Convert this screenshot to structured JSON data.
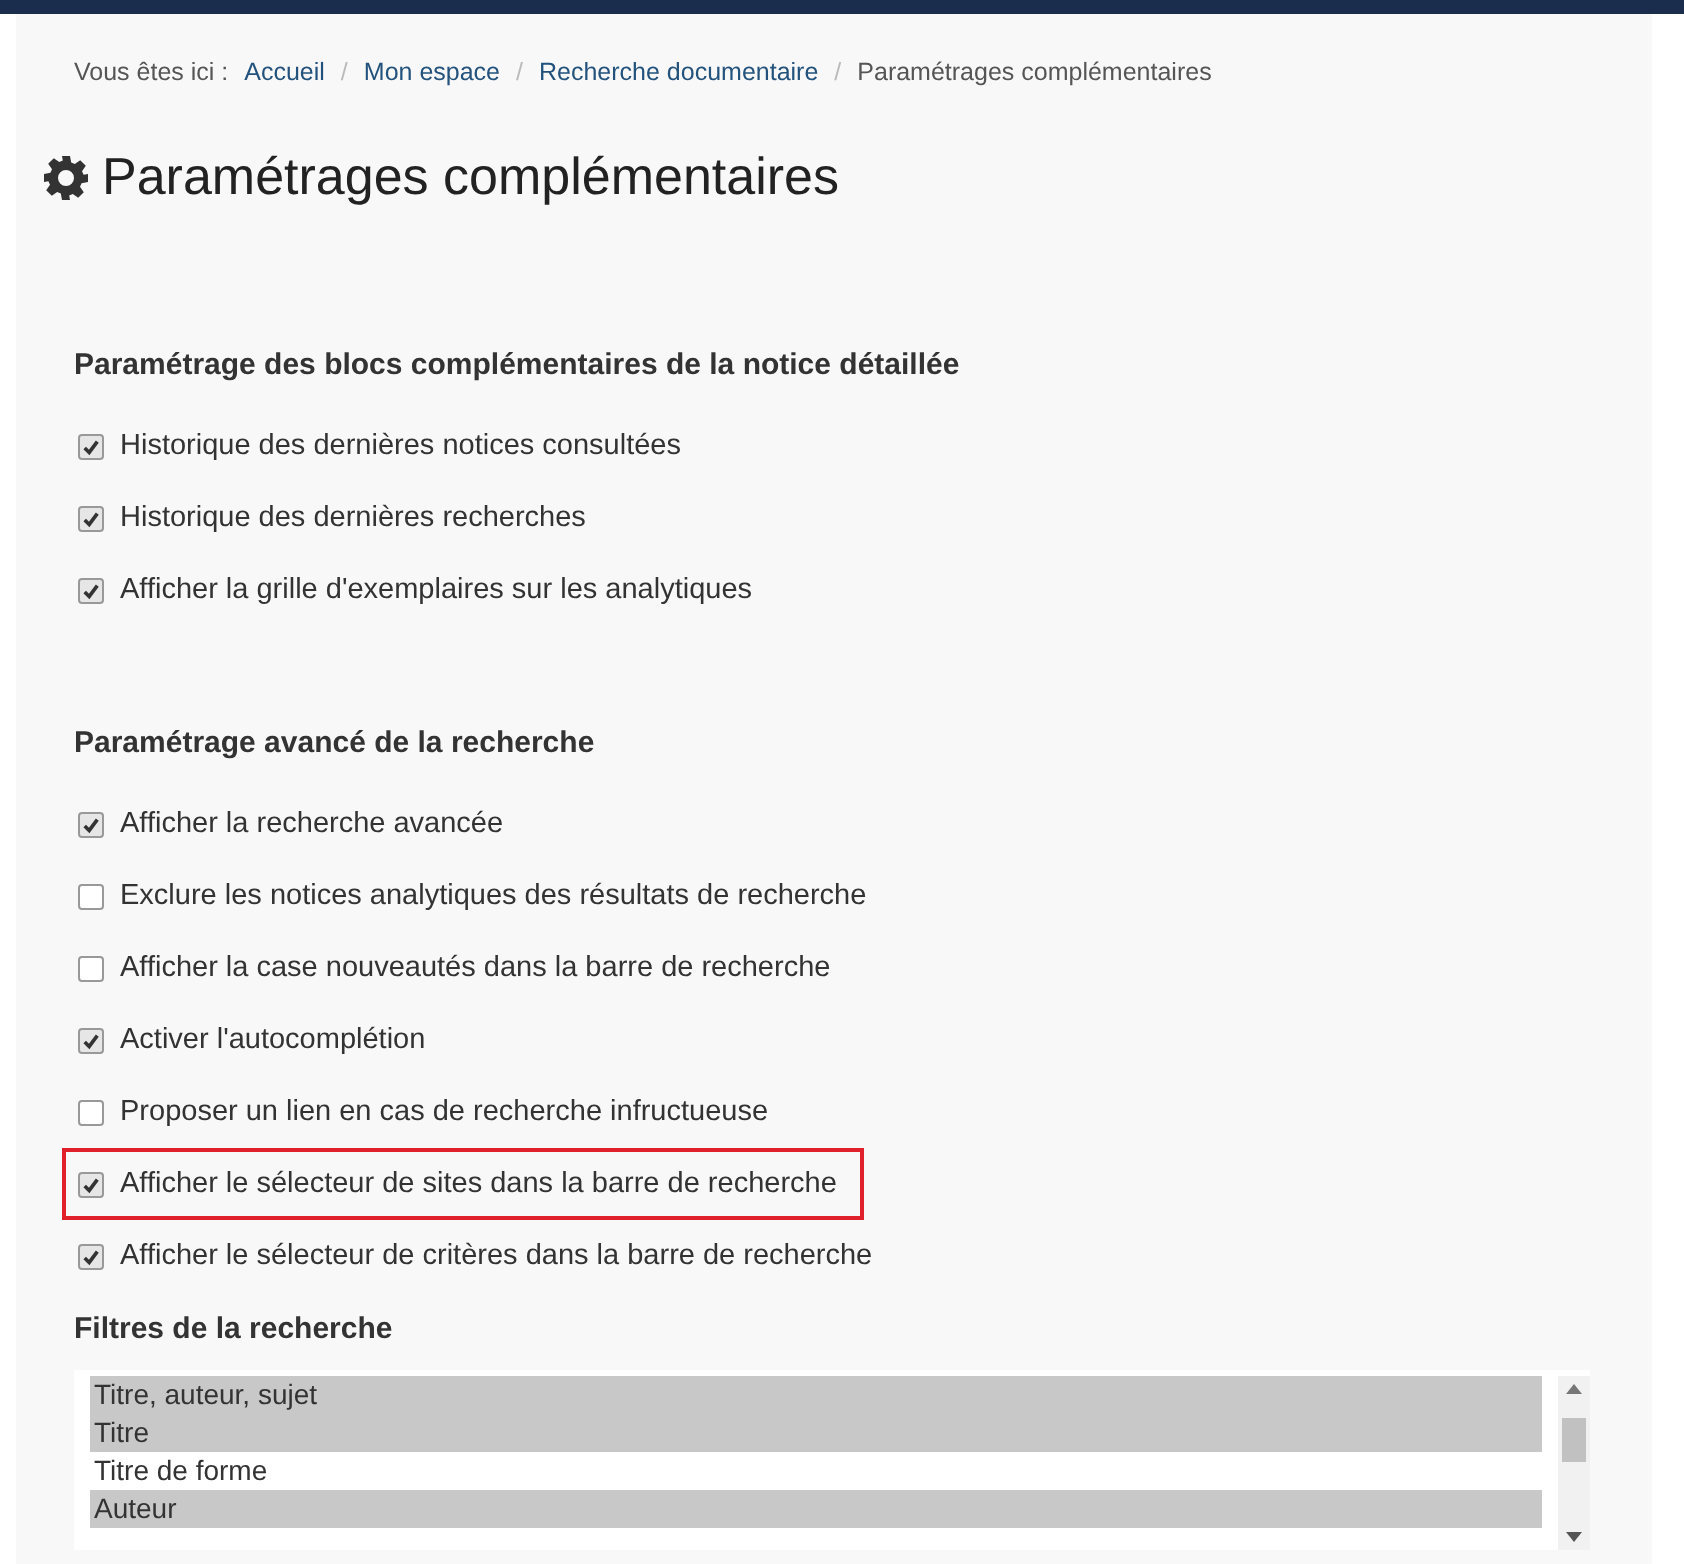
{
  "breadcrumb": {
    "label": "Vous êtes ici :",
    "separator": "/",
    "items": [
      {
        "text": "Accueil",
        "kind": "link"
      },
      {
        "text": "Mon espace",
        "kind": "link"
      },
      {
        "text": "Recherche documentaire",
        "kind": "link"
      },
      {
        "text": "Paramétrages complémentaires",
        "kind": "current"
      }
    ]
  },
  "title": "Paramétrages complémentaires",
  "sections": [
    {
      "heading": "Paramétrage des blocs complémentaires de la notice détaillée",
      "options": [
        {
          "label": "Historique des dernières notices consultées",
          "checked": true,
          "highlighted": false
        },
        {
          "label": "Historique des dernières recherches",
          "checked": true,
          "highlighted": false
        },
        {
          "label": "Afficher la grille d'exemplaires sur les analytiques",
          "checked": true,
          "highlighted": false
        }
      ]
    },
    {
      "heading": "Paramétrage avancé de la recherche",
      "options": [
        {
          "label": "Afficher la recherche avancée",
          "checked": true,
          "highlighted": false
        },
        {
          "label": "Exclure les notices analytiques des résultats de recherche",
          "checked": false,
          "highlighted": false
        },
        {
          "label": "Afficher la case nouveautés dans la barre de recherche",
          "checked": false,
          "highlighted": false
        },
        {
          "label": "Activer l'autocomplétion",
          "checked": true,
          "highlighted": false
        },
        {
          "label": "Proposer un lien en cas de recherche infructueuse",
          "checked": false,
          "highlighted": false
        },
        {
          "label": "Afficher le sélecteur de sites dans la barre de recherche",
          "checked": true,
          "highlighted": true
        },
        {
          "label": "Afficher le sélecteur de critères dans la barre de recherche",
          "checked": true,
          "highlighted": false
        }
      ]
    }
  ],
  "filters": {
    "heading": "Filtres de la recherche",
    "items": [
      {
        "text": "Titre, auteur, sujet",
        "selected": true
      },
      {
        "text": "Titre",
        "selected": true
      },
      {
        "text": "Titre de forme",
        "selected": false
      },
      {
        "text": "Auteur",
        "selected": true
      }
    ]
  }
}
